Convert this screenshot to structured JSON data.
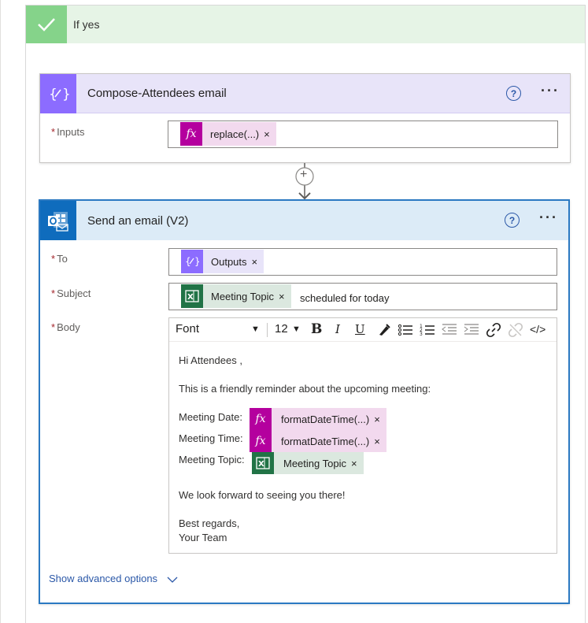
{
  "condition": {
    "label": "If yes"
  },
  "compose": {
    "title": "Compose-Attendees email",
    "inputs_label": "Inputs",
    "inputs_token": {
      "text": "replace(...)",
      "close": "×"
    }
  },
  "connector": {
    "add_label": "+"
  },
  "email": {
    "title": "Send an email (V2)",
    "to_label": "To",
    "to_token": {
      "text": "Outputs",
      "close": "×"
    },
    "subject_label": "Subject",
    "subject_token": {
      "text": "Meeting Topic",
      "close": "×"
    },
    "subject_text": "scheduled for today",
    "body_label": "Body",
    "toolbar": {
      "font": "Font",
      "size": "12",
      "bold": "B",
      "italic": "I",
      "underline": "U",
      "code": "</>"
    },
    "body": {
      "greeting": "Hi Attendees ,",
      "intro": "This is a friendly reminder about the upcoming meeting:",
      "date_label": "Meeting Date:",
      "date_token": "formatDateTime(...)",
      "time_label": "Meeting Time:",
      "time_token": "formatDateTime(...)",
      "topic_label": "Meeting Topic:",
      "topic_token": "Meeting Topic",
      "close_x": "×",
      "closing": "We look forward to seeing you there!",
      "regards": "Best regards,",
      "team": "Your Team"
    },
    "advanced": "Show advanced options"
  },
  "required_mark": "*",
  "colors": {
    "compose_purple": "#8c6cff",
    "compose_bg": "#e8e4f9",
    "outlook_blue": "#0f6cbd",
    "email_bg": "#dcebf7",
    "expr_magenta": "#b4009e",
    "expr_bg": "#f2d9ee",
    "excel_green": "#217346",
    "excel_bg": "#dbe8df",
    "condition_green": "#85d38a"
  }
}
